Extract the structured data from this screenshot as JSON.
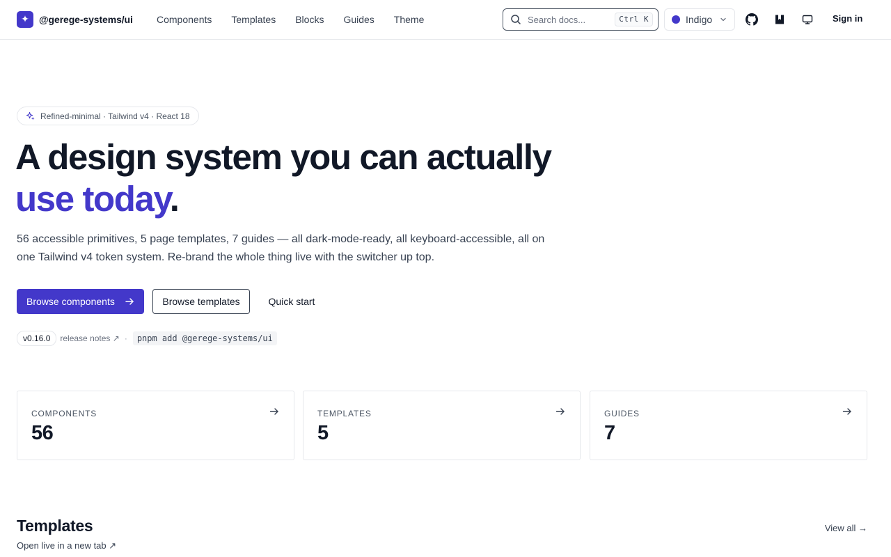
{
  "colors": {
    "accent": "#4338ca",
    "text": "#111827",
    "muted": "#6b7280",
    "border": "#e5e7eb"
  },
  "brand": {
    "icon": "sparkle-icon",
    "glyph": "✦",
    "name": "@gerege-systems/ui"
  },
  "nav": {
    "items": [
      {
        "label": "Components"
      },
      {
        "label": "Templates"
      },
      {
        "label": "Blocks"
      },
      {
        "label": "Guides"
      },
      {
        "label": "Theme"
      }
    ]
  },
  "search": {
    "placeholder": "Search docs...",
    "shortcut": "Ctrl K"
  },
  "theme": {
    "selected": "Indigo",
    "swatch": "#4338ca"
  },
  "header_icons": [
    "github-icon",
    "storybook-icon",
    "monitor-icon"
  ],
  "auth": {
    "signin_label": "Sign in"
  },
  "hero": {
    "badge_icon": "sparkles-icon",
    "badge": "Refined-minimal · Tailwind v4 · React 18",
    "headline": "A design system you can actually",
    "headline_accent": "use today",
    "headline_end": ".",
    "lead": "56 accessible primitives, 5 page templates, 7 guides — all dark-mode-ready, all keyboard-accessible, all on one Tailwind v4 token system. Re-brand the whole thing live with the switcher up top.",
    "primary_cta": "Browse components",
    "secondary_cta": "Browse templates",
    "tertiary_cta": "Quick start",
    "version": "v0.16.0",
    "release_notes": "release notes ↗",
    "separator": "·",
    "install": "pnpm add @gerege-systems/ui"
  },
  "stats": [
    {
      "label": "COMPONENTS",
      "value": "56"
    },
    {
      "label": "TEMPLATES",
      "value": "5"
    },
    {
      "label": "GUIDES",
      "value": "7"
    }
  ],
  "templates_section": {
    "title": "Templates",
    "subtitle": "Open live in a new tab ↗",
    "view_all": "View all →"
  }
}
